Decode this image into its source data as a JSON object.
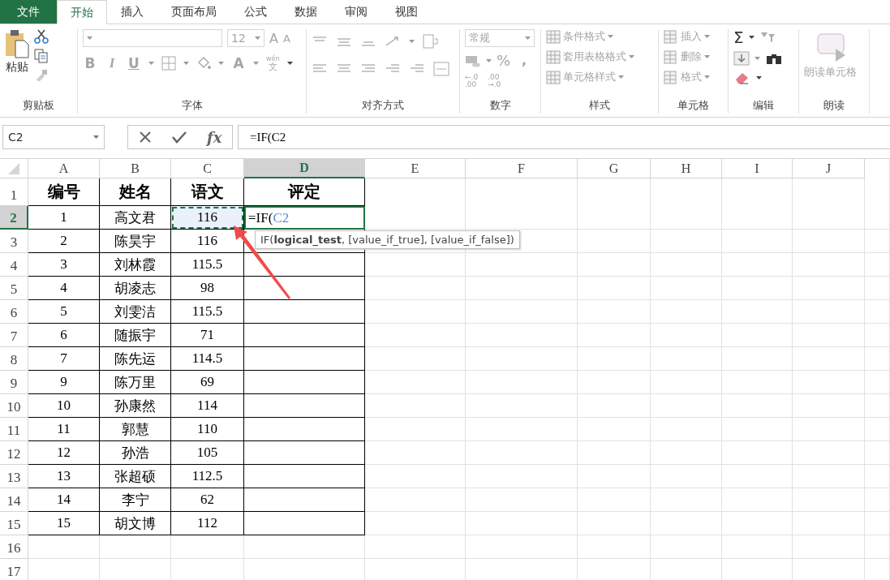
{
  "tabs": [
    {
      "label": "文件",
      "kind": "file",
      "selected": false
    },
    {
      "label": "开始",
      "kind": "tab",
      "selected": true
    },
    {
      "label": "插入",
      "kind": "tab",
      "selected": false
    },
    {
      "label": "页面布局",
      "kind": "tab",
      "selected": false
    },
    {
      "label": "公式",
      "kind": "tab",
      "selected": false
    },
    {
      "label": "数据",
      "kind": "tab",
      "selected": false
    },
    {
      "label": "审阅",
      "kind": "tab",
      "selected": false
    },
    {
      "label": "视图",
      "kind": "tab",
      "selected": false
    }
  ],
  "ribbon": {
    "disabled": true,
    "clipboard": {
      "label": "剪贴板",
      "paste": "粘贴"
    },
    "font": {
      "label": "字体",
      "size": "12",
      "grow": "A",
      "shrink": "A",
      "bold": "B",
      "italic": "I",
      "underline": "U",
      "font_color": "A",
      "phonetic": "wén",
      "phonetic_char": "文"
    },
    "alignment": {
      "label": "对齐方式"
    },
    "number": {
      "label": "数字",
      "format": "常规",
      "percent": "%",
      "comma": ",",
      "increase_decimal": [
        "←.0",
        ".00"
      ],
      "decrease_decimal": [
        ".00",
        "→.0"
      ]
    },
    "styles": {
      "label": "样式",
      "buttons": [
        "条件格式",
        "套用表格格式",
        "单元格样式"
      ]
    },
    "cells": {
      "label": "单元格",
      "buttons": [
        "插入",
        "删除",
        "格式"
      ]
    },
    "editing": {
      "label": "编辑",
      "sum": "Σ"
    },
    "read": {
      "label": "朗读",
      "button": "朗读单元格"
    }
  },
  "formula_bar": {
    "name_box": "C2",
    "fx": "fx",
    "formula": "=IF(C2"
  },
  "columns": [
    {
      "label": "A",
      "selected": false
    },
    {
      "label": "B",
      "selected": false
    },
    {
      "label": "C",
      "selected": false
    },
    {
      "label": "D",
      "selected": true
    },
    {
      "label": "E",
      "selected": false
    },
    {
      "label": "F",
      "selected": false
    },
    {
      "label": "G",
      "selected": false
    },
    {
      "label": "H",
      "selected": false
    },
    {
      "label": "I",
      "selected": false
    },
    {
      "label": "J",
      "selected": false
    }
  ],
  "rows": [
    {
      "header": "1",
      "selected": false,
      "cells": [
        {
          "text": "编号",
          "marked": false
        },
        {
          "text": "姓名",
          "marked": false
        },
        {
          "text": "语文",
          "marked": false
        },
        {
          "text": "评定",
          "marked": false
        }
      ]
    },
    {
      "header": "2",
      "selected": true,
      "cells": [
        {
          "text": "1",
          "marked": false
        },
        {
          "text": "高文君",
          "marked": false
        },
        {
          "text": "116",
          "marked": true
        }
      ],
      "editor": {
        "text": "=IF(",
        "ref": "C2"
      }
    },
    {
      "header": "3",
      "selected": false,
      "cells": [
        {
          "text": "2",
          "marked": false
        },
        {
          "text": "陈昊宇",
          "marked": false
        },
        {
          "text": "116",
          "marked": false
        }
      ]
    },
    {
      "header": "4",
      "selected": false,
      "cells": [
        {
          "text": "3",
          "marked": false
        },
        {
          "text": "刘林霞",
          "marked": false
        },
        {
          "text": "115.5",
          "marked": false
        }
      ]
    },
    {
      "header": "5",
      "selected": false,
      "cells": [
        {
          "text": "4",
          "marked": false
        },
        {
          "text": "胡凌志",
          "marked": false
        },
        {
          "text": "98",
          "marked": false
        }
      ]
    },
    {
      "header": "6",
      "selected": false,
      "cells": [
        {
          "text": "5",
          "marked": false
        },
        {
          "text": "刘雯洁",
          "marked": false
        },
        {
          "text": "115.5",
          "marked": false
        }
      ]
    },
    {
      "header": "7",
      "selected": false,
      "cells": [
        {
          "text": "6",
          "marked": false
        },
        {
          "text": "随振宇",
          "marked": false
        },
        {
          "text": "71",
          "marked": false
        }
      ]
    },
    {
      "header": "8",
      "selected": false,
      "cells": [
        {
          "text": "7",
          "marked": false
        },
        {
          "text": "陈先运",
          "marked": false
        },
        {
          "text": "114.5",
          "marked": false
        }
      ]
    },
    {
      "header": "9",
      "selected": false,
      "cells": [
        {
          "text": "9",
          "marked": false
        },
        {
          "text": "陈万里",
          "marked": false
        },
        {
          "text": "69",
          "marked": false
        }
      ]
    },
    {
      "header": "10",
      "selected": false,
      "cells": [
        {
          "text": "10",
          "marked": false
        },
        {
          "text": "孙康然",
          "marked": false
        },
        {
          "text": "114",
          "marked": false
        }
      ]
    },
    {
      "header": "11",
      "selected": false,
      "cells": [
        {
          "text": "11",
          "marked": false
        },
        {
          "text": "郭慧",
          "marked": false
        },
        {
          "text": "110",
          "marked": false
        }
      ]
    },
    {
      "header": "12",
      "selected": false,
      "cells": [
        {
          "text": "12",
          "marked": false
        },
        {
          "text": "孙浩",
          "marked": false
        },
        {
          "text": "105",
          "marked": false
        }
      ]
    },
    {
      "header": "13",
      "selected": false,
      "cells": [
        {
          "text": "13",
          "marked": false
        },
        {
          "text": "张超硕",
          "marked": false
        },
        {
          "text": "112.5",
          "marked": false
        }
      ]
    },
    {
      "header": "14",
      "selected": false,
      "cells": [
        {
          "text": "14",
          "marked": false
        },
        {
          "text": "李宁",
          "marked": false
        },
        {
          "text": "62",
          "marked": false
        }
      ]
    },
    {
      "header": "15",
      "selected": false,
      "cells": [
        {
          "text": "15",
          "marked": false
        },
        {
          "text": "胡文博",
          "marked": false
        },
        {
          "text": "112",
          "marked": false
        }
      ]
    },
    {
      "header": "16",
      "selected": false,
      "cells": []
    },
    {
      "header": "17",
      "selected": false,
      "cells": []
    }
  ],
  "tooltip": "IF(**logical_test**, [value_if_true], [value_if_false])"
}
